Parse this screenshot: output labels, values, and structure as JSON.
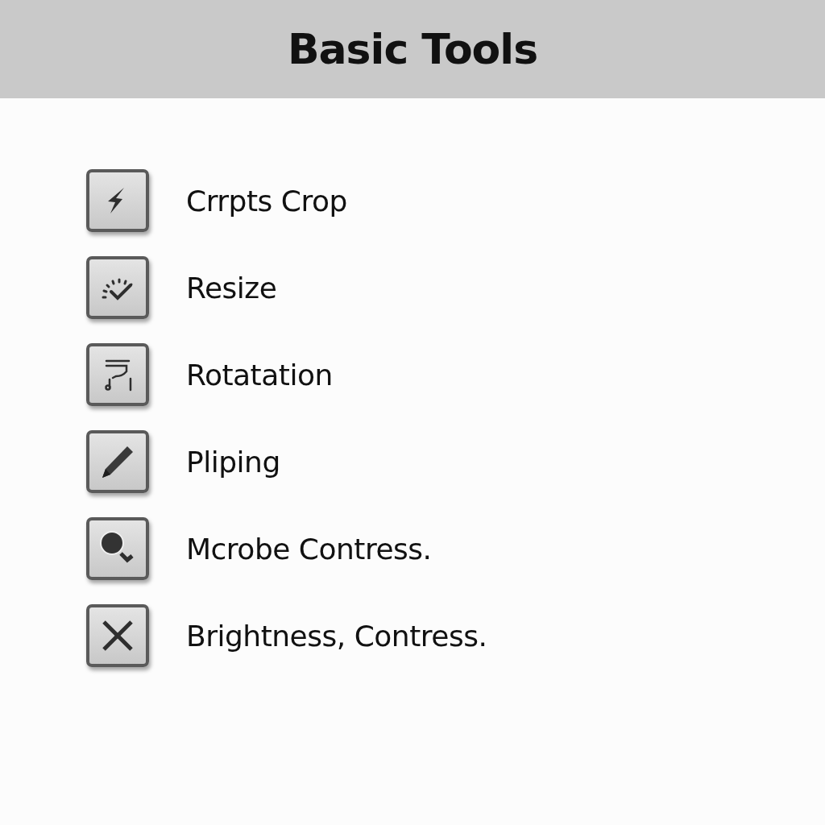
{
  "header": {
    "title": "Basic Tools"
  },
  "tools": [
    {
      "kind": "bolt",
      "label": "Crrpts Crop"
    },
    {
      "kind": "gauge",
      "label": "Resize"
    },
    {
      "kind": "rotate",
      "label": "Rotatation"
    },
    {
      "kind": "pencil",
      "label": "Pliping"
    },
    {
      "kind": "magnifier",
      "label": "Mcrobe Contress."
    },
    {
      "kind": "cross",
      "label": "Brightness, Contress."
    }
  ]
}
